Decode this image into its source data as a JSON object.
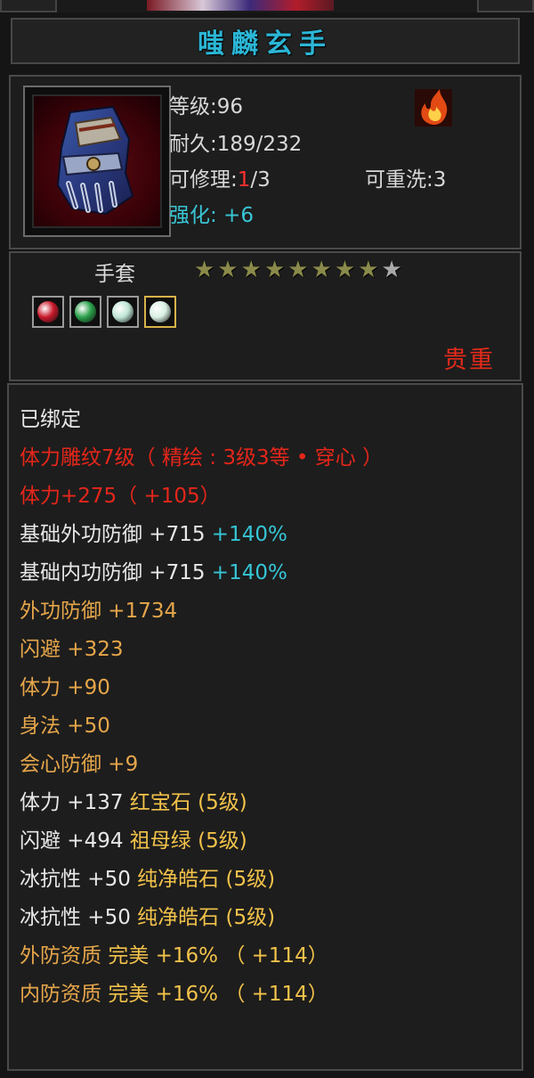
{
  "item": {
    "name": "嗤麟玄手",
    "level_line": "等级:96",
    "durability_line": "耐久:189/232",
    "repair_label": "可修理:",
    "repair_current": "1",
    "repair_max": "/3",
    "rewash_line": "可重洗:3",
    "enhance_line": "强化: +6",
    "type": "手套",
    "stars_total": 9,
    "stars_filled": 8,
    "rarity": "贵重",
    "icon": "armored-gauntlet-icon",
    "badge_icon": "fire-emblem-icon"
  },
  "gems": [
    {
      "icon": "ruby-gem-icon",
      "color": "#c8182a"
    },
    {
      "icon": "emerald-gem-icon",
      "color": "#2aa04a"
    },
    {
      "icon": "pure-diamond-gem-icon",
      "color": "#bfe6d6"
    },
    {
      "icon": "pure-diamond-gem-icon",
      "color": "#d9efe3"
    }
  ],
  "attributes": [
    {
      "text": "已绑定",
      "color": "white"
    },
    {
      "text": "体力雕纹7级（ 精绘 : 3级3等 • 穿心 ）",
      "color": "red"
    },
    {
      "text": "体力+275（ +105）",
      "color": "red"
    },
    {
      "text": "基础外功防御  +715 ",
      "extra": "+140%",
      "color": "white"
    },
    {
      "text": "基础内功防御  +715 ",
      "extra": "+140%",
      "color": "white"
    },
    {
      "text": "外功防御  +1734",
      "color": "orange"
    },
    {
      "text": "闪避  +323",
      "color": "orange"
    },
    {
      "text": "体力  +90",
      "color": "orange"
    },
    {
      "text": "身法  +50",
      "color": "orange"
    },
    {
      "text": "会心防御  +9",
      "color": "orange"
    },
    {
      "text": "体力  +137  红宝石 (5级)",
      "color": "white",
      "colored_part": "红宝石 (5级)"
    },
    {
      "text": "闪避  +494  祖母绿 (5级)",
      "color": "white",
      "colored_part": "祖母绿 (5级)"
    },
    {
      "text": "冰抗性  +50  纯净皓石 (5级)",
      "color": "white",
      "colored_part": "纯净皓石 (5级)"
    },
    {
      "text": "冰抗性  +50  纯净皓石 (5级)",
      "color": "white",
      "colored_part": "纯净皓石 (5级)"
    },
    {
      "text": "外防资质   完美  +16% （ +114）",
      "color": "orange",
      "colored_part": "完美  +16% （ +114）"
    },
    {
      "text": "内防资质   完美  +16% （ +114）",
      "color": "orange",
      "colored_part": "完美  +16% （ +114）"
    }
  ],
  "colors": {
    "title": "#2bb6d6",
    "enhance": "#39c6d6",
    "red": "#e5261a",
    "orange": "#e6a64a",
    "gem_yellow": "#f2c24a",
    "gem_cyan": "#35c6d6"
  }
}
